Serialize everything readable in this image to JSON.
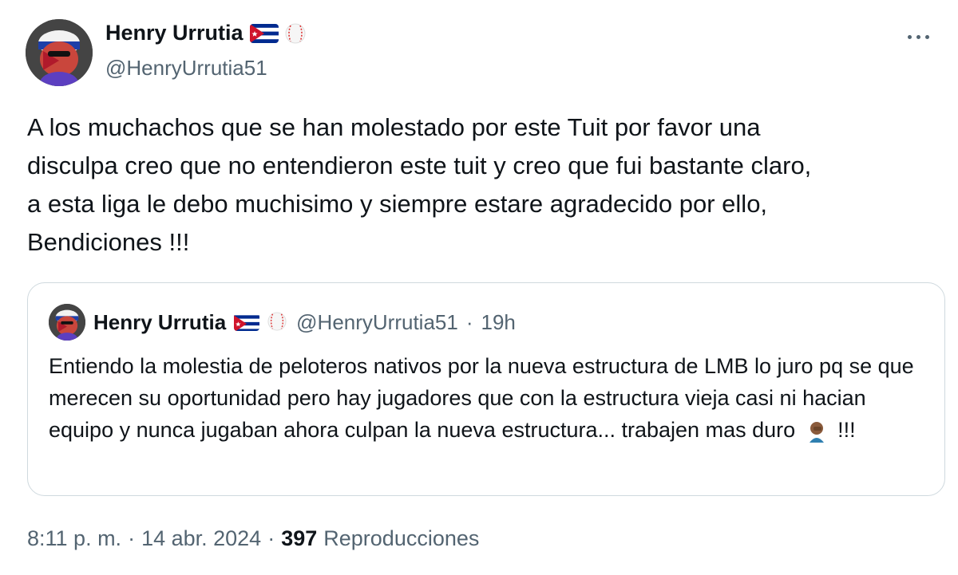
{
  "author": {
    "display_name": "Henry Urrutia",
    "handle": "@HenryUrrutia51",
    "flag_icon": "cuba-flag-icon",
    "extra_icon": "baseball-icon"
  },
  "tweet": {
    "text": "A los muchachos que se han molestado por este Tuit por favor una\ndisculpa creo que no entendieron este tuit y creo que fui bastante claro,\na esta liga le debo muchisimo y siempre estare agradecido por ello,\nBendiciones !!!"
  },
  "quote": {
    "display_name": "Henry Urrutia",
    "handle": "@HenryUrrutia51",
    "separator": "·",
    "time": "19h",
    "text_main": "Entiendo la molestia de peloteros nativos por la nueva estructura de LMB lo juro pq se que merecen su oportunidad pero hay jugadores que con la estructura vieja casi ni hacian equipo y nunca jugaban ahora culpan la nueva estructura... trabajen mas duro",
    "text_tail": "!!!",
    "emoji": "facepalm-emoji"
  },
  "meta": {
    "time": "8:11 p. m.",
    "sep1": "·",
    "date": "14 abr. 2024",
    "sep2": "·",
    "views_count": "397",
    "views_label": "Reproducciones"
  },
  "colors": {
    "text": "#0f1419",
    "secondary": "#536471",
    "border": "#cfd9de",
    "cuba_blue": "#002a8f",
    "cuba_red": "#cf142b"
  }
}
